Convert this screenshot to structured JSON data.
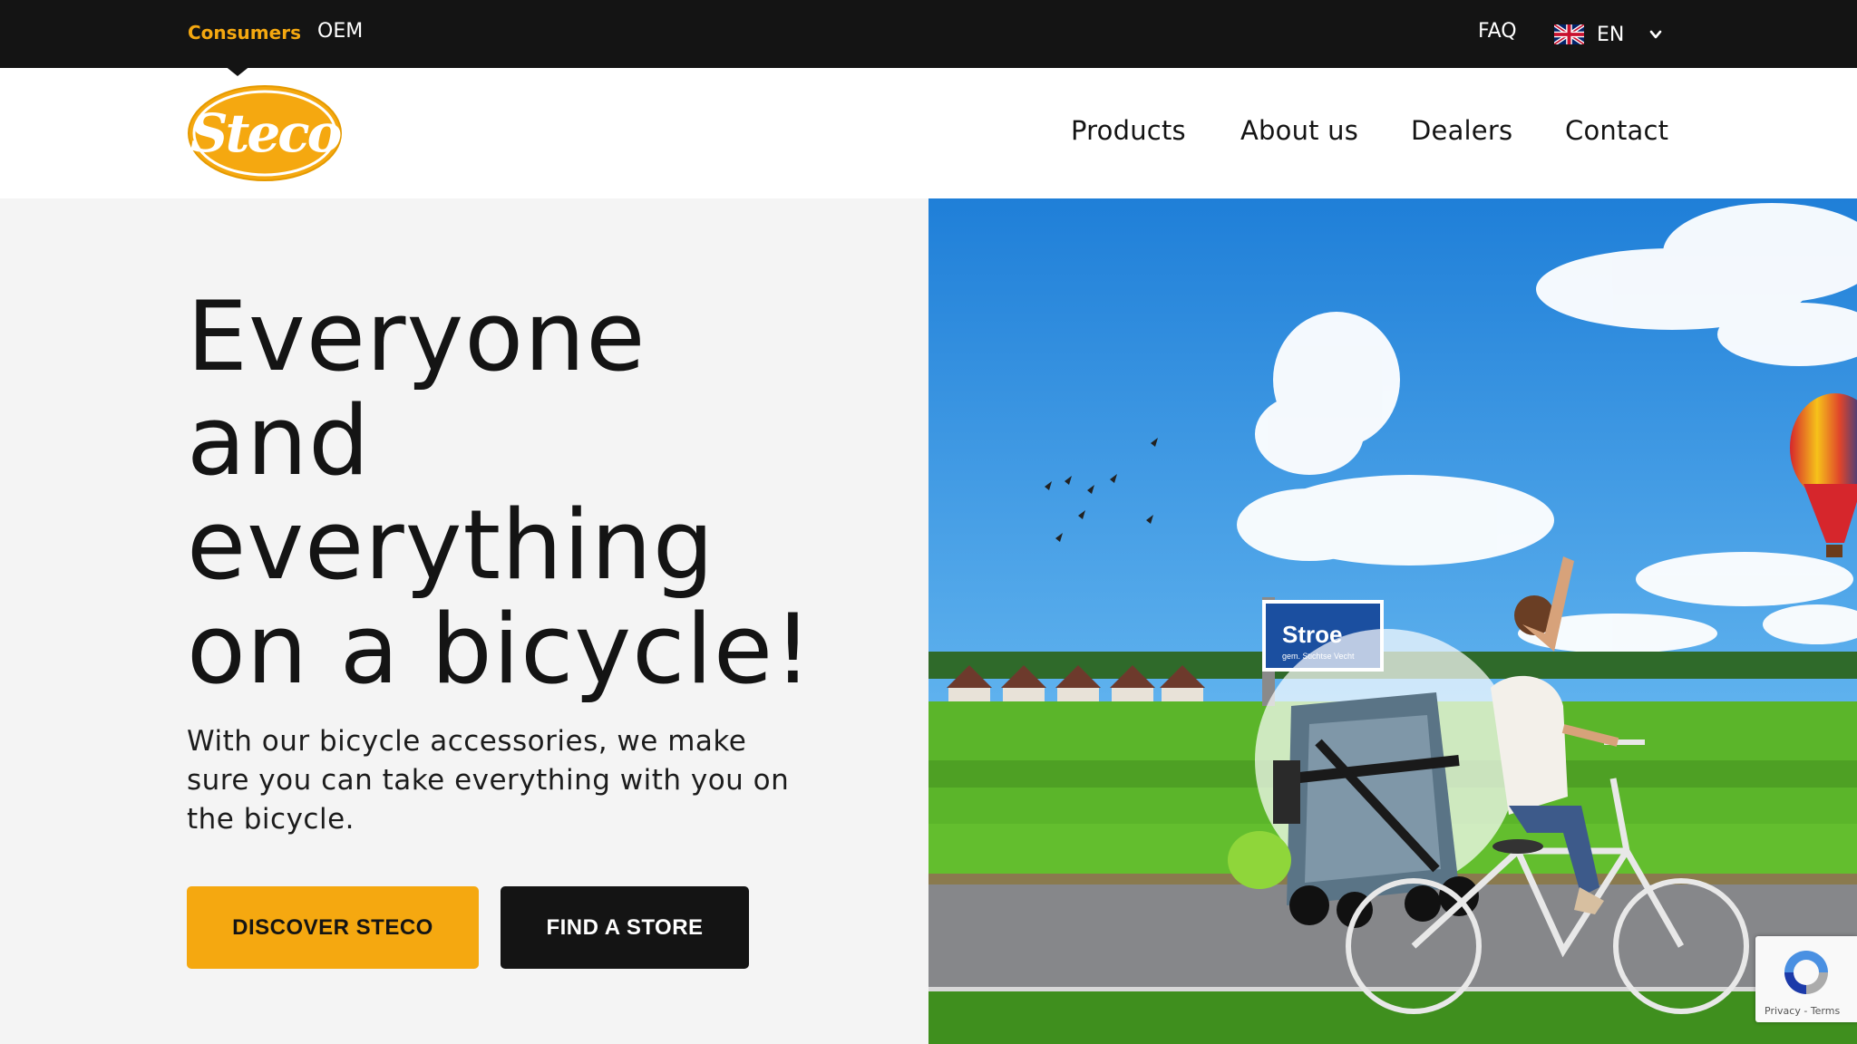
{
  "topbar": {
    "consumers_label": "Consumers",
    "oem_label": "OEM",
    "faq_label": "FAQ",
    "language_code": "EN"
  },
  "header": {
    "logo_text": "Steco",
    "nav": {
      "products": "Products",
      "about": "About us",
      "dealers": "Dealers",
      "contact": "Contact"
    }
  },
  "hero": {
    "title_lines": [
      "Everyone",
      "and",
      "everything",
      "on a bicycle!"
    ],
    "subtitle": "With our bicycle accessories, we make sure you can take everything with you on the bicycle.",
    "primary_button": "DISCOVER STECO",
    "secondary_button": "FIND A STORE",
    "sign_text": "Stroe",
    "sign_subtext": "gem. Stichtse Vecht"
  },
  "recaptcha": {
    "privacy": "Privacy",
    "separator": "-",
    "terms": "Terms"
  },
  "colors": {
    "brand_yellow": "#f5a810",
    "dark": "#141414",
    "hero_bg": "#f4f4f4",
    "sky": "#2f8fde",
    "grass": "#5bb52a"
  },
  "icons": [
    "uk-flag-icon",
    "chevron-down-icon",
    "recaptcha-icon"
  ]
}
